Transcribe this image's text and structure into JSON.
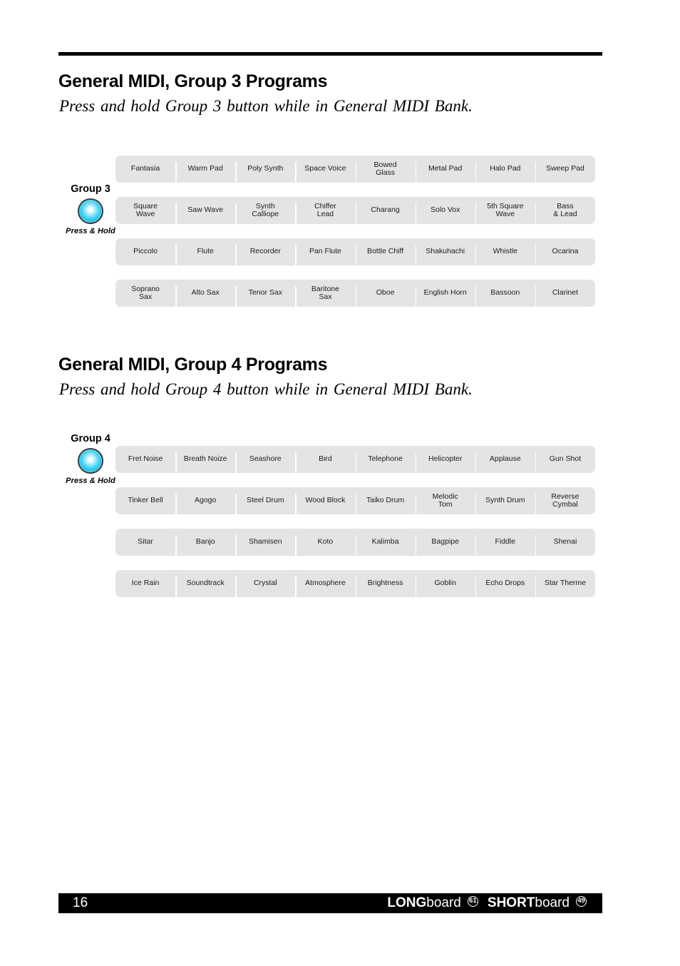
{
  "document": {
    "page_number": "16",
    "footer": {
      "brand_long_prefix": "LONG",
      "brand_long_suffix": "board",
      "brand_long_keys": "61",
      "brand_short_prefix": "SHORT",
      "brand_short_suffix": "board",
      "brand_short_keys": "49"
    }
  },
  "sections": [
    {
      "id": "group3",
      "title": "General MIDI, Group 3 Programs",
      "subtitle": "Press and hold Group 3 button while in General MIDI Bank.",
      "button": {
        "label": "Group 3",
        "sub_label": "Press & Hold",
        "color": "#16c0ee"
      },
      "rows": [
        [
          "Fantasia",
          "Warm Pad",
          "Poly Synth",
          "Space Voice",
          "Bowed\nGlass",
          "Metal Pad",
          "Halo Pad",
          "Sweep Pad"
        ],
        [
          "Square\nWave",
          "Saw Wave",
          "Synth\nCalliope",
          "Chiffer\nLead",
          "Charang",
          "Solo Vox",
          "5th Square\nWave",
          "Bass\n& Lead"
        ],
        [
          "Piccolo",
          "Flute",
          "Recorder",
          "Pan Flute",
          "Bottle Chiff",
          "Shakuhachi",
          "Whistle",
          "Ocarina"
        ],
        [
          "Soprano\nSax",
          "Alto Sax",
          "Tenor Sax",
          "Baritone\nSax",
          "Oboe",
          "English Horn",
          "Bassoon",
          "Clarinet"
        ]
      ]
    },
    {
      "id": "group4",
      "title": "General MIDI, Group 4 Programs",
      "subtitle": "Press and hold Group 4 button while in General MIDI Bank.",
      "button": {
        "label": "Group 4",
        "sub_label": "Press & Hold",
        "color": "#16c0ee"
      },
      "rows": [
        [
          "Fret Noise",
          "Breath Noize",
          "Seashore",
          "Bird",
          "Telephone",
          "Helicopter",
          "Applause",
          "Gun Shot"
        ],
        [
          "Tinker Bell",
          "Agogo",
          "Steel Drum",
          "Wood Block",
          "Taiko Drum",
          "Melodic\nTom",
          "Synth Drum",
          "Reverse\nCymbal"
        ],
        [
          "Sitar",
          "Banjo",
          "Shamisen",
          "Koto",
          "Kalimba",
          "Bagpipe",
          "Fiddle",
          "Shenai"
        ],
        [
          "Ice Rain",
          "Soundtrack",
          "Crystal",
          "Atmosphere",
          "Brightness",
          "Goblin",
          "Echo Drops",
          "Star Therme"
        ]
      ]
    }
  ]
}
